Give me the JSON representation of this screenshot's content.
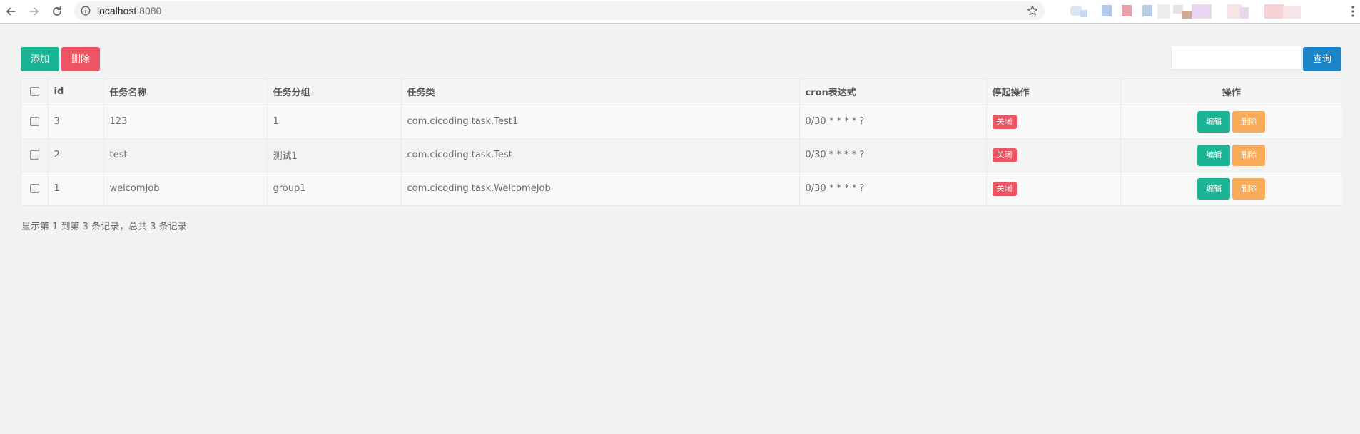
{
  "browser": {
    "url_host": "localhost",
    "url_port": ":8080"
  },
  "toolbar": {
    "add_label": "添加",
    "delete_label": "删除",
    "search_placeholder": "",
    "search_value": "",
    "search_label": "查询"
  },
  "table": {
    "columns": {
      "id": "id",
      "name": "任务名称",
      "group": "任务分组",
      "class": "任务类",
      "cron": "cron表达式",
      "toggle": "停起操作",
      "ops": "操作"
    },
    "rows": [
      {
        "id": "3",
        "name": "123",
        "group": "1",
        "class": "com.cicoding.task.Test1",
        "cron": "0/30 * * * * ?",
        "status_label": "关闭",
        "edit_label": "编辑",
        "remove_label": "删除"
      },
      {
        "id": "2",
        "name": "test",
        "group": "测试1",
        "class": "com.cicoding.task.Test",
        "cron": "0/30 * * * * ?",
        "status_label": "关闭",
        "edit_label": "编辑",
        "remove_label": "删除"
      },
      {
        "id": "1",
        "name": "welcomJob",
        "group": "group1",
        "class": "com.cicoding.task.WelcomeJob",
        "cron": "0/30 * * * * ?",
        "status_label": "关闭",
        "edit_label": "编辑",
        "remove_label": "删除"
      }
    ]
  },
  "pagination": {
    "info": "显示第 1 到第 3 条记录，总共 3 条记录"
  },
  "colors": {
    "primary": "#1ab394",
    "danger": "#ed5565",
    "warning": "#f8ac59",
    "info": "#1c84c6",
    "background": "#f2f2f2"
  }
}
